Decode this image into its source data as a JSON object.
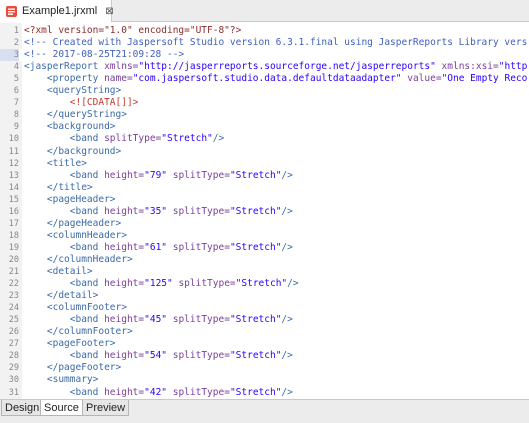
{
  "tab": {
    "label": "Example1.jrxml",
    "close_glyph": "⊠"
  },
  "bottom_tabs": [
    "Design",
    "Source",
    "Preview"
  ],
  "active_bottom_tab": "Source",
  "lines": [
    {
      "n": "1",
      "segments": [
        {
          "c": "pi",
          "t": "<?xml version=\"1.0\" encoding=\"UTF-8\"?>"
        }
      ]
    },
    {
      "n": "2",
      "segments": [
        {
          "c": "c",
          "t": "<!-- Created with Jaspersoft Studio version 6.3.1.final using JasperReports Library vers"
        }
      ]
    },
    {
      "n": "3",
      "segments": [
        {
          "c": "c",
          "t": "<!-- 2017-08-25T21:09:28 -->"
        }
      ]
    },
    {
      "n": "4",
      "segments": [
        {
          "c": "t",
          "t": "<jasperReport"
        },
        {
          "c": "an",
          "t": " xmlns="
        },
        {
          "c": "v",
          "t": "\"http://jasperreports.sourceforge.net/jasperreports\""
        },
        {
          "c": "an",
          "t": " xmlns:xsi="
        },
        {
          "c": "v",
          "t": "\"http"
        }
      ]
    },
    {
      "n": "5",
      "segments": [
        {
          "c": "t",
          "t": "    <property"
        },
        {
          "c": "an",
          "t": " name="
        },
        {
          "c": "v",
          "t": "\"com.jaspersoft.studio.data.defaultdataadapter\""
        },
        {
          "c": "an",
          "t": " value="
        },
        {
          "c": "v",
          "t": "\"One Empty Reco"
        }
      ]
    },
    {
      "n": "6",
      "segments": [
        {
          "c": "t",
          "t": "    <queryString>"
        }
      ]
    },
    {
      "n": "7",
      "segments": [
        {
          "c": "t",
          "t": "        "
        },
        {
          "c": "cd",
          "t": "<![CDATA[]]>"
        }
      ]
    },
    {
      "n": "8",
      "segments": [
        {
          "c": "t",
          "t": "    </queryString>"
        }
      ]
    },
    {
      "n": "9",
      "segments": [
        {
          "c": "t",
          "t": "    <background>"
        }
      ]
    },
    {
      "n": "10",
      "segments": [
        {
          "c": "t",
          "t": "        <band"
        },
        {
          "c": "an",
          "t": " splitType="
        },
        {
          "c": "v",
          "t": "\"Stretch\""
        },
        {
          "c": "t",
          "t": "/>"
        }
      ]
    },
    {
      "n": "11",
      "segments": [
        {
          "c": "t",
          "t": "    </background>"
        }
      ]
    },
    {
      "n": "12",
      "segments": [
        {
          "c": "t",
          "t": "    <title>"
        }
      ]
    },
    {
      "n": "13",
      "segments": [
        {
          "c": "t",
          "t": "        <band"
        },
        {
          "c": "an",
          "t": " height="
        },
        {
          "c": "v",
          "t": "\"79\""
        },
        {
          "c": "an",
          "t": " splitType="
        },
        {
          "c": "v",
          "t": "\"Stretch\""
        },
        {
          "c": "t",
          "t": "/>"
        }
      ]
    },
    {
      "n": "14",
      "segments": [
        {
          "c": "t",
          "t": "    </title>"
        }
      ]
    },
    {
      "n": "15",
      "segments": [
        {
          "c": "t",
          "t": "    <pageHeader>"
        }
      ]
    },
    {
      "n": "16",
      "segments": [
        {
          "c": "t",
          "t": "        <band"
        },
        {
          "c": "an",
          "t": " height="
        },
        {
          "c": "v",
          "t": "\"35\""
        },
        {
          "c": "an",
          "t": " splitType="
        },
        {
          "c": "v",
          "t": "\"Stretch\""
        },
        {
          "c": "t",
          "t": "/>"
        }
      ]
    },
    {
      "n": "17",
      "segments": [
        {
          "c": "t",
          "t": "    </pageHeader>"
        }
      ]
    },
    {
      "n": "18",
      "segments": [
        {
          "c": "t",
          "t": "    <columnHeader>"
        }
      ]
    },
    {
      "n": "19",
      "segments": [
        {
          "c": "t",
          "t": "        <band"
        },
        {
          "c": "an",
          "t": " height="
        },
        {
          "c": "v",
          "t": "\"61\""
        },
        {
          "c": "an",
          "t": " splitType="
        },
        {
          "c": "v",
          "t": "\"Stretch\""
        },
        {
          "c": "t",
          "t": "/>"
        }
      ]
    },
    {
      "n": "20",
      "segments": [
        {
          "c": "t",
          "t": "    </columnHeader>"
        }
      ]
    },
    {
      "n": "21",
      "segments": [
        {
          "c": "t",
          "t": "    <detail>"
        }
      ]
    },
    {
      "n": "22",
      "segments": [
        {
          "c": "t",
          "t": "        <band"
        },
        {
          "c": "an",
          "t": " height="
        },
        {
          "c": "v",
          "t": "\"125\""
        },
        {
          "c": "an",
          "t": " splitType="
        },
        {
          "c": "v",
          "t": "\"Stretch\""
        },
        {
          "c": "t",
          "t": "/>"
        }
      ]
    },
    {
      "n": "23",
      "segments": [
        {
          "c": "t",
          "t": "    </detail>"
        }
      ]
    },
    {
      "n": "24",
      "segments": [
        {
          "c": "t",
          "t": "    <columnFooter>"
        }
      ]
    },
    {
      "n": "25",
      "segments": [
        {
          "c": "t",
          "t": "        <band"
        },
        {
          "c": "an",
          "t": " height="
        },
        {
          "c": "v",
          "t": "\"45\""
        },
        {
          "c": "an",
          "t": " splitType="
        },
        {
          "c": "v",
          "t": "\"Stretch\""
        },
        {
          "c": "t",
          "t": "/>"
        }
      ]
    },
    {
      "n": "26",
      "segments": [
        {
          "c": "t",
          "t": "    </columnFooter>"
        }
      ]
    },
    {
      "n": "27",
      "segments": [
        {
          "c": "t",
          "t": "    <pageFooter>"
        }
      ]
    },
    {
      "n": "28",
      "segments": [
        {
          "c": "t",
          "t": "        <band"
        },
        {
          "c": "an",
          "t": " height="
        },
        {
          "c": "v",
          "t": "\"54\""
        },
        {
          "c": "an",
          "t": " splitType="
        },
        {
          "c": "v",
          "t": "\"Stretch\""
        },
        {
          "c": "t",
          "t": "/>"
        }
      ]
    },
    {
      "n": "29",
      "segments": [
        {
          "c": "t",
          "t": "    </pageFooter>"
        }
      ]
    },
    {
      "n": "30",
      "segments": [
        {
          "c": "t",
          "t": "    <summary>"
        }
      ]
    },
    {
      "n": "31",
      "segments": [
        {
          "c": "t",
          "t": "        <band"
        },
        {
          "c": "an",
          "t": " height="
        },
        {
          "c": "v",
          "t": "\"42\""
        },
        {
          "c": "an",
          "t": " splitType="
        },
        {
          "c": "v",
          "t": "\"Stretch\""
        },
        {
          "c": "t",
          "t": "/>"
        }
      ]
    }
  ],
  "current_line": "3"
}
